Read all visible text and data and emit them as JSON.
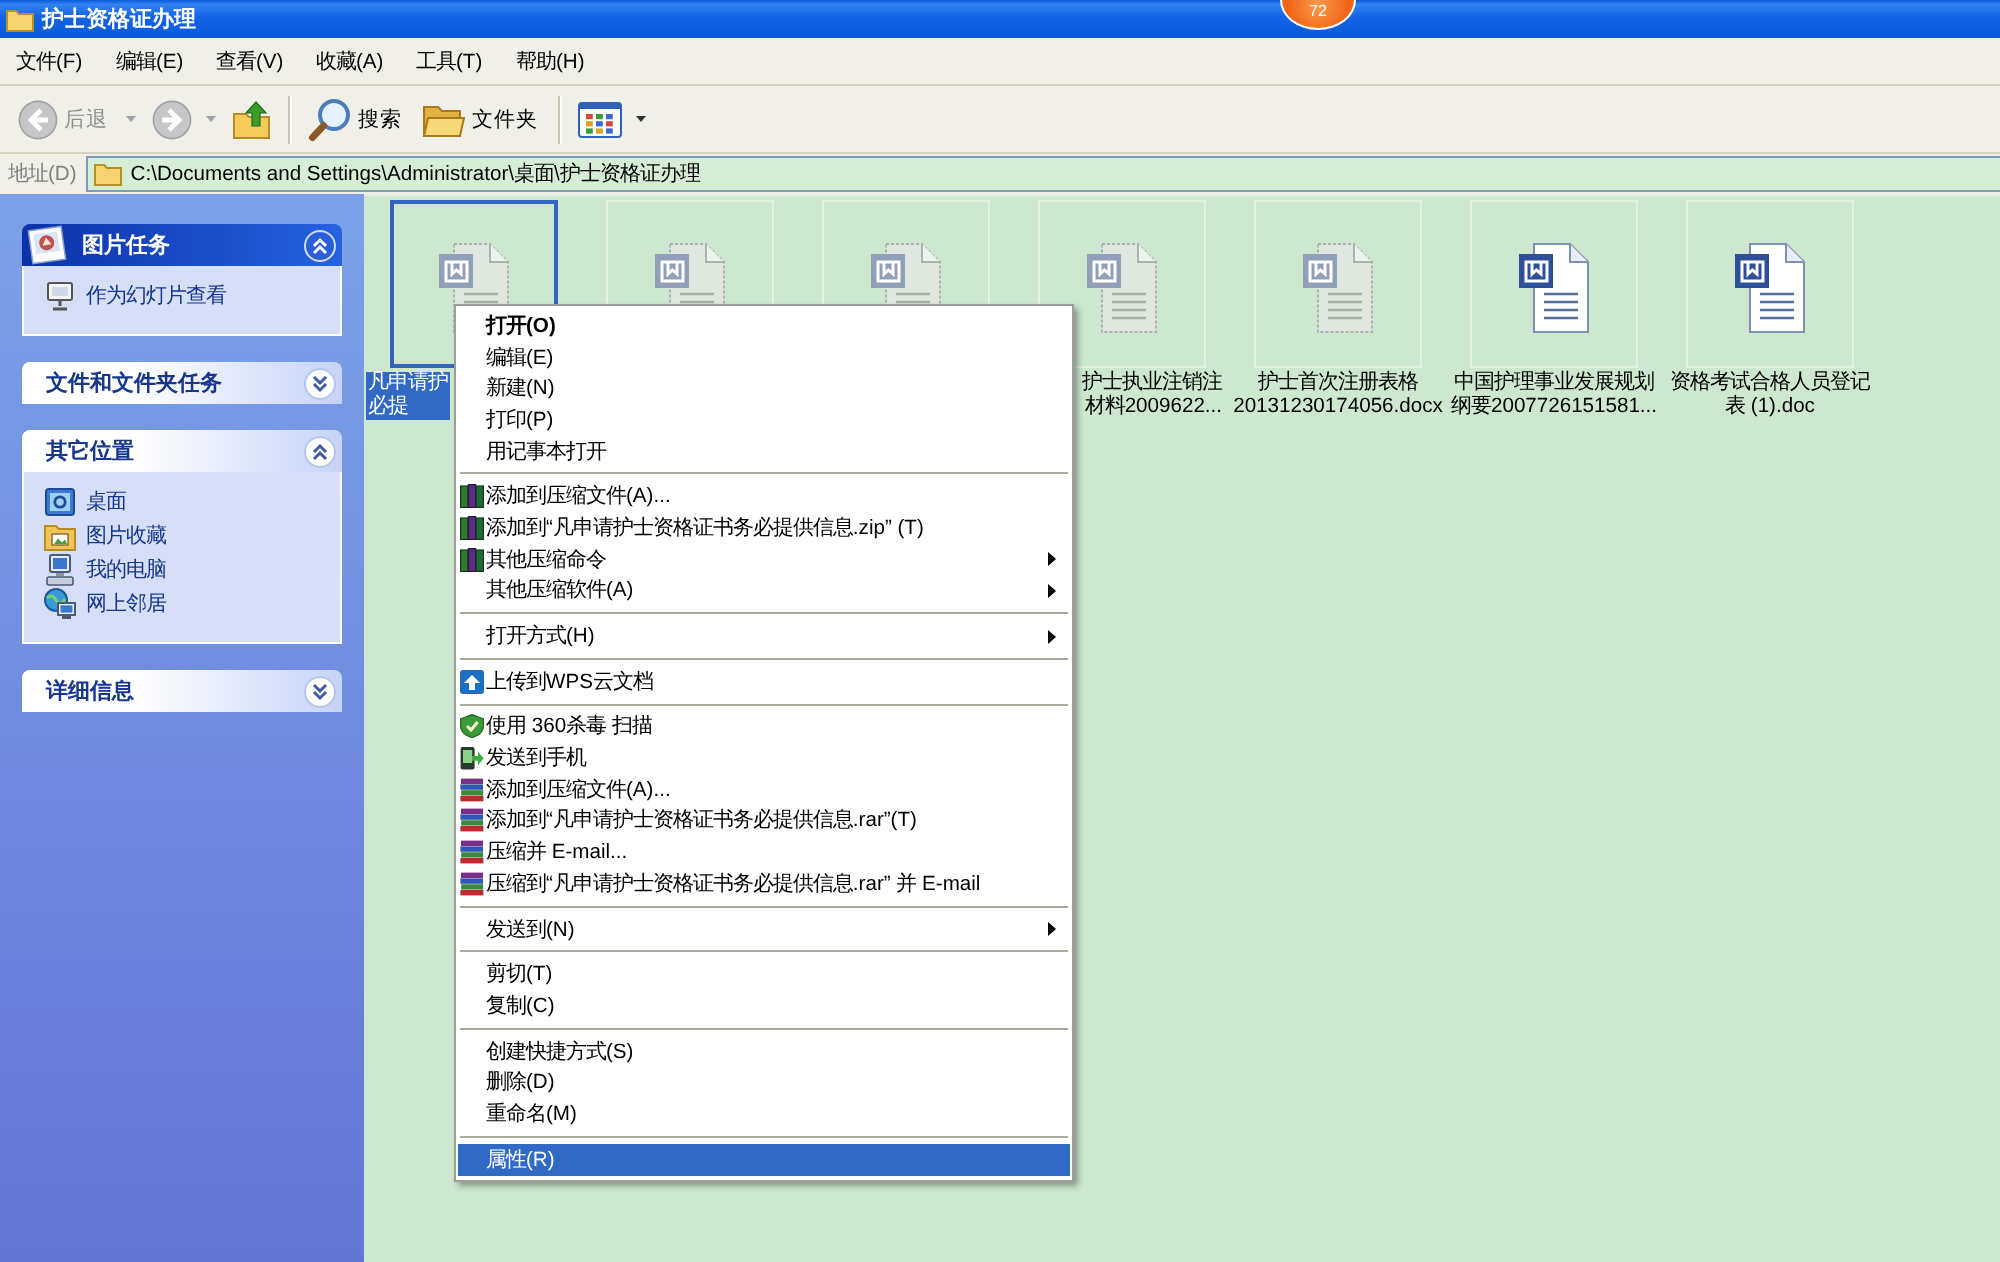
{
  "window": {
    "title": "护士资格证办理",
    "badge": "72"
  },
  "menu_bar": [
    "文件(F)",
    "编辑(E)",
    "查看(V)",
    "收藏(A)",
    "工具(T)",
    "帮助(H)"
  ],
  "toolbar": {
    "buttons": [
      {
        "kind": "back",
        "label": "后退",
        "disabled": true,
        "dropdown": true
      },
      {
        "kind": "forward",
        "disabled": true,
        "dropdown": true
      },
      {
        "kind": "up",
        "disabled": false,
        "dropdown": false
      },
      {
        "kind": "separator"
      },
      {
        "kind": "search",
        "label": "搜索",
        "disabled": false,
        "dropdown": false
      },
      {
        "kind": "folders",
        "label": "文件夹",
        "disabled": false,
        "dropdown": false
      },
      {
        "kind": "separator"
      },
      {
        "kind": "views",
        "disabled": false,
        "dropdown": true
      }
    ]
  },
  "address_bar": {
    "label": "地址(D)",
    "value": "C:\\Documents and Settings\\Administrator\\桌面\\护士资格证办理"
  },
  "sidebar": {
    "panels": [
      {
        "title": "图片任务",
        "kind": "special",
        "expanded": true,
        "items": [
          {
            "kind": "slideshow",
            "label": "作为幻灯片查看"
          }
        ]
      },
      {
        "title": "文件和文件夹任务",
        "kind": "normal",
        "expanded": false
      },
      {
        "title": "其它位置",
        "kind": "normal",
        "expanded": true,
        "items": [
          {
            "kind": "desktop",
            "label": "桌面"
          },
          {
            "kind": "pictures",
            "label": "图片收藏"
          },
          {
            "kind": "computer",
            "label": "我的电脑"
          },
          {
            "kind": "network",
            "label": "网上邻居"
          }
        ]
      },
      {
        "title": "详细信息",
        "kind": "normal",
        "expanded": false
      }
    ]
  },
  "files": [
    {
      "lines": [
        "凡申请护",
        "必提"
      ],
      "selected": true,
      "faded": true
    },
    {
      "selected": false,
      "faded": true
    },
    {
      "selected": false,
      "faded": true
    },
    {
      "lines": [
        "护士执业注销注",
        "材料2009622..."
      ],
      "selected": false,
      "faded": true
    },
    {
      "lines": [
        "护士首次注册表格",
        "20131230174056.docx"
      ],
      "selected": false,
      "faded": true
    },
    {
      "lines": [
        "中国护理事业发展规划",
        "纲要2007726151581..."
      ],
      "selected": false,
      "faded": false
    },
    {
      "lines": [
        "资格考试合格人员登记",
        "表 (1).doc"
      ],
      "selected": false,
      "faded": false
    }
  ],
  "context_menu": {
    "items": [
      {
        "kind": "command",
        "label": "打开(O)",
        "default": true,
        "submenu": false,
        "selected": false
      },
      {
        "kind": "command",
        "label": "编辑(E)",
        "default": false,
        "submenu": false,
        "selected": false
      },
      {
        "kind": "command",
        "label": "新建(N)",
        "default": false,
        "submenu": false,
        "selected": false
      },
      {
        "kind": "command",
        "label": "打印(P)",
        "default": false,
        "submenu": false,
        "selected": false
      },
      {
        "kind": "command",
        "label": "用记事本打开",
        "default": false,
        "submenu": false,
        "selected": false
      },
      {
        "kind": "separator"
      },
      {
        "kind": "winzip",
        "label": "添加到压缩文件(A)...",
        "default": false,
        "submenu": false,
        "selected": false
      },
      {
        "kind": "winzip",
        "label": "添加到“凡申请护士资格证书务必提供信息.zip” (T)",
        "default": false,
        "submenu": false,
        "selected": false
      },
      {
        "kind": "winzip",
        "label": "其他压缩命令",
        "default": false,
        "submenu": true,
        "selected": false
      },
      {
        "kind": "command",
        "label": "其他压缩软件(A)",
        "default": false,
        "submenu": true,
        "selected": false
      },
      {
        "kind": "separator"
      },
      {
        "kind": "command",
        "label": "打开方式(H)",
        "default": false,
        "submenu": true,
        "selected": false
      },
      {
        "kind": "separator"
      },
      {
        "kind": "wps",
        "label": "上传到WPS云文档",
        "default": false,
        "submenu": false,
        "selected": false
      },
      {
        "kind": "separator"
      },
      {
        "kind": "scan",
        "label": "使用 360杀毒 扫描",
        "default": false,
        "submenu": false,
        "selected": false
      },
      {
        "kind": "phone",
        "label": "发送到手机",
        "default": false,
        "submenu": false,
        "selected": false
      },
      {
        "kind": "winrar",
        "label": "添加到压缩文件(A)...",
        "default": false,
        "submenu": false,
        "selected": false
      },
      {
        "kind": "winrar",
        "label": "添加到“凡申请护士资格证书务必提供信息.rar”(T)",
        "default": false,
        "submenu": false,
        "selected": false
      },
      {
        "kind": "winrar",
        "label": "压缩并 E-mail...",
        "default": false,
        "submenu": false,
        "selected": false
      },
      {
        "kind": "winrar",
        "label": "压缩到“凡申请护士资格证书务必提供信息.rar” 并 E-mail",
        "default": false,
        "submenu": false,
        "selected": false
      },
      {
        "kind": "separator"
      },
      {
        "kind": "command",
        "label": "发送到(N)",
        "default": false,
        "submenu": true,
        "selected": false
      },
      {
        "kind": "separator"
      },
      {
        "kind": "command",
        "label": "剪切(T)",
        "default": false,
        "submenu": false,
        "selected": false
      },
      {
        "kind": "command",
        "label": "复制(C)",
        "default": false,
        "submenu": false,
        "selected": false
      },
      {
        "kind": "separator"
      },
      {
        "kind": "command",
        "label": "创建快捷方式(S)",
        "default": false,
        "submenu": false,
        "selected": false
      },
      {
        "kind": "command",
        "label": "删除(D)",
        "default": false,
        "submenu": false,
        "selected": false
      },
      {
        "kind": "command",
        "label": "重命名(M)",
        "default": false,
        "submenu": false,
        "selected": false
      },
      {
        "kind": "separator"
      },
      {
        "kind": "command",
        "label": "属性(R)",
        "default": false,
        "submenu": false,
        "selected": true
      }
    ]
  }
}
